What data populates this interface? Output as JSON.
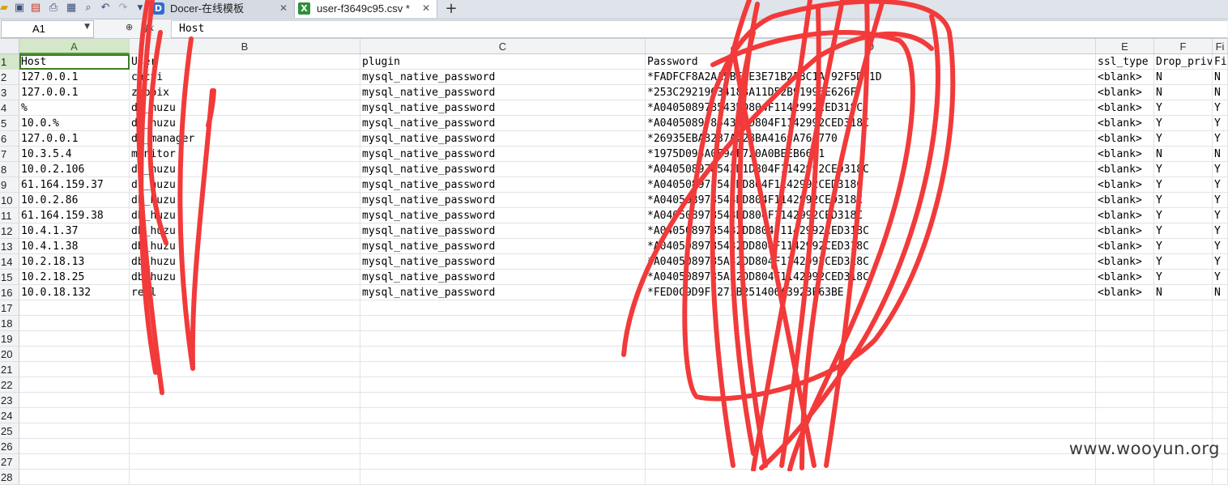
{
  "toolbar": {
    "icons": [
      "open-icon",
      "save-icon",
      "export-pdf-icon",
      "print-icon",
      "print-preview-icon",
      "find-icon",
      "undo-icon",
      "redo-icon",
      "quick-access-dropdown-icon"
    ]
  },
  "tabs": [
    {
      "label": "Docer-在线模板",
      "icon_text": "D",
      "close": "✕"
    },
    {
      "label": "user-f3649c95.csv *",
      "icon_text": "X",
      "close": "✕"
    }
  ],
  "add_tab": "+",
  "formula_bar": {
    "name_box": "A1",
    "fx": "fx",
    "value": "Host"
  },
  "columns": [
    {
      "letter": "A",
      "width": 136
    },
    {
      "letter": "B",
      "width": 285
    },
    {
      "letter": "C",
      "width": 352
    },
    {
      "letter": "D",
      "width": 556
    },
    {
      "letter": "E",
      "width": 72
    },
    {
      "letter": "F",
      "width": 72
    },
    {
      "letter": "Fi",
      "width": 19
    }
  ],
  "rows": [
    [
      "Host",
      "User",
      "plugin",
      "Password",
      "ssl_type",
      "Drop_priv",
      "Fi"
    ],
    [
      "127.0.0.1",
      "cacti",
      "mysql_native_password",
      "*FADFCF8A2AA5BEAE3E71B2F3C1A792F5D71D",
      "<blank>",
      "N",
      "N"
    ],
    [
      "127.0.0.1",
      "zabbix",
      "mysql_native_password",
      "*253C29219034183A11D52B91996E626F",
      "<blank>",
      "N",
      "N"
    ],
    [
      "%",
      "db_huzu",
      "mysql_native_password",
      "*A040508978543DD804F1142992CED318C",
      "<blank>",
      "Y",
      "Y"
    ],
    [
      "10.0.%",
      "db_huzu",
      "mysql_native_password",
      "*A0405089785432DD804F1142992CED318C",
      "<blank>",
      "Y",
      "Y"
    ],
    [
      "127.0.0.1",
      "db_manager",
      "mysql_native_password",
      "*26935EBA3237A228BA4166A76A770",
      "<blank>",
      "Y",
      "Y"
    ],
    [
      "10.3.5.4",
      "monitor",
      "mysql_native_password",
      "*1975D095A0F94F720A0BEEB66F1",
      "<blank>",
      "N",
      "N"
    ],
    [
      "10.0.2.106",
      "db_huzu",
      "mysql_native_password",
      "*A040508978543D1D804F1142992CED318C",
      "<blank>",
      "Y",
      "Y"
    ],
    [
      "61.164.159.37",
      "db_huzu",
      "mysql_native_password",
      "*A040508978543DD804F1142992CED318C",
      "<blank>",
      "Y",
      "Y"
    ],
    [
      "10.0.2.86",
      "db_huzu",
      "mysql_native_password",
      "*A040508978543DD804F1142992CED318C",
      "<blank>",
      "Y",
      "Y"
    ],
    [
      "61.164.159.38",
      "db_huzu",
      "mysql_native_password",
      "*A040508978543DD804F1142992CED318C",
      "<blank>",
      "Y",
      "Y"
    ],
    [
      "10.4.1.37",
      "db_huzu",
      "mysql_native_password",
      "*A0405089785432DD804F1142992CED318C",
      "<blank>",
      "Y",
      "Y"
    ],
    [
      "10.4.1.38",
      "db_huzu",
      "mysql_native_password",
      "*A0405089785432DD804F1142992CED318C",
      "<blank>",
      "Y",
      "Y"
    ],
    [
      "10.2.18.13",
      "db_huzu",
      "mysql_native_password",
      "*A0405089785A32DD804F1142992CED318C",
      "<blank>",
      "Y",
      "Y"
    ],
    [
      "10.2.18.25",
      "db_huzu",
      "mysql_native_password",
      "*A0405089785A32DD804F1142992CED318C",
      "<blank>",
      "Y",
      "Y"
    ],
    [
      "10.0.18.132",
      "repl",
      "mysql_native_password",
      "*FED0C9D9F1271B251406A3923E63BE",
      "<blank>",
      "N",
      "N"
    ],
    [
      "",
      "",
      "",
      "",
      "",
      "",
      ""
    ],
    [
      "",
      "",
      "",
      "",
      "",
      "",
      ""
    ],
    [
      "",
      "",
      "",
      "",
      "",
      "",
      ""
    ],
    [
      "",
      "",
      "",
      "",
      "",
      "",
      ""
    ],
    [
      "",
      "",
      "",
      "",
      "",
      "",
      ""
    ],
    [
      "",
      "",
      "",
      "",
      "",
      "",
      ""
    ],
    [
      "",
      "",
      "",
      "",
      "",
      "",
      ""
    ],
    [
      "",
      "",
      "",
      "",
      "",
      "",
      ""
    ],
    [
      "",
      "",
      "",
      "",
      "",
      "",
      ""
    ],
    [
      "",
      "",
      "",
      "",
      "",
      "",
      ""
    ],
    [
      "",
      "",
      "",
      "",
      "",
      "",
      ""
    ],
    [
      "",
      "",
      "",
      "",
      "",
      "",
      ""
    ]
  ],
  "row_numbers": [
    "1",
    "2",
    "3",
    "4",
    "5",
    "6",
    "7",
    "8",
    "9",
    "10",
    "11",
    "12",
    "13",
    "14",
    "15",
    "16",
    "17",
    "18",
    "19",
    "20",
    "21",
    "22",
    "23",
    "24",
    "25",
    "26",
    "27",
    "28"
  ],
  "watermark": "www.wooyun.org",
  "colors": {
    "scribble": "#f23a3a",
    "active_header": "#d4e7c8",
    "selection": "#3e7d25"
  }
}
